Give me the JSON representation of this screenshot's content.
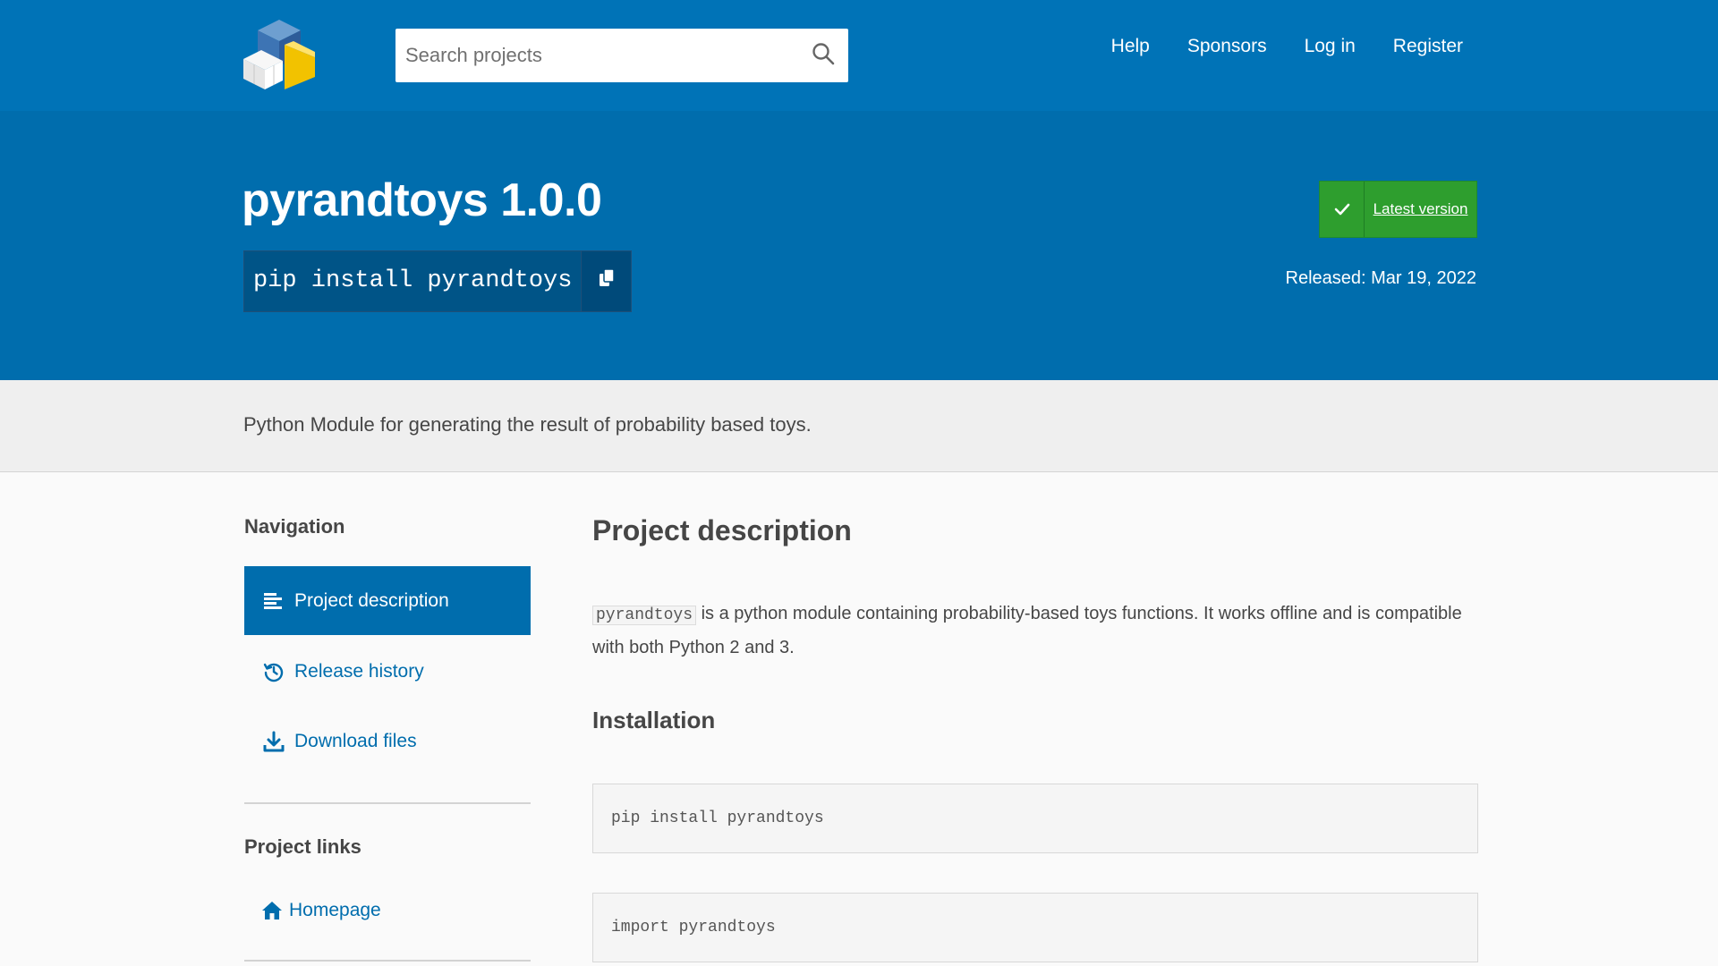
{
  "header": {
    "logo_icon": "pypi-logo-icon",
    "search": {
      "placeholder": "Search projects",
      "value": ""
    },
    "nav": [
      "Help",
      "Sponsors",
      "Log in",
      "Register"
    ]
  },
  "banner": {
    "title": "pyrandtoys 1.0.0",
    "pip_command": "pip install pyrandtoys",
    "latest_label": "Latest version",
    "released": "Released: Mar 19, 2022"
  },
  "summary": "Python Module for generating the result of probability based toys.",
  "sidebar": {
    "navigation_heading": "Navigation",
    "items": [
      {
        "label": "Project description",
        "icon": "align-left-icon",
        "active": true
      },
      {
        "label": "Release history",
        "icon": "history-icon",
        "active": false
      },
      {
        "label": "Download files",
        "icon": "download-icon",
        "active": false
      }
    ],
    "links_heading": "Project links",
    "links": [
      {
        "label": "Homepage",
        "icon": "home-icon"
      }
    ]
  },
  "main": {
    "heading": "Project description",
    "intro_code": "pyrandtoys",
    "intro_text": " is a python module containing probability-based toys functions. It works offline and is compatible with both Python 2 and 3.",
    "install_heading": "Installation",
    "code_blocks": [
      "pip install pyrandtoys",
      "import pyrandtoys"
    ]
  },
  "colors": {
    "header_blue": "#0073b7",
    "banner_blue": "#006dad",
    "latest_green": "#2e9e2e",
    "summary_bg": "#efefef"
  }
}
